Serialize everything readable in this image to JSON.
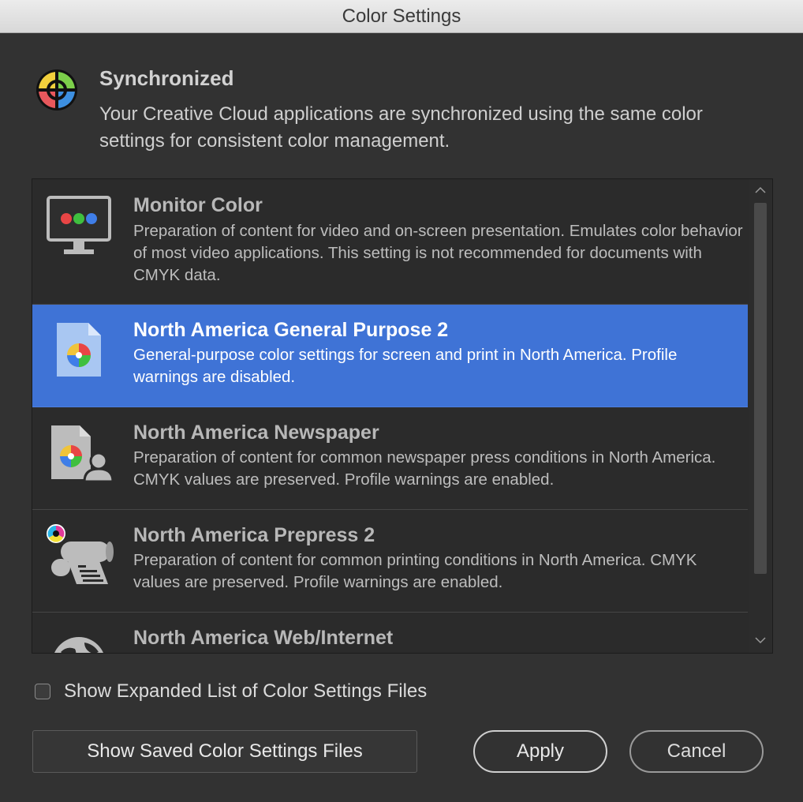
{
  "window": {
    "title": "Color Settings"
  },
  "sync": {
    "icon": "color-wheel-icon",
    "title": "Synchronized",
    "description": "Your Creative Cloud applications are synchronized using the same color settings for consistent color management."
  },
  "settings_list": {
    "items": [
      {
        "name": "Monitor Color",
        "description": "Preparation of content for video and on-screen presentation. Emulates color behavior of most video applications. This setting is not recommended for documents with CMYK data.",
        "icon": "monitor-icon",
        "selected": false
      },
      {
        "name": "North America General Purpose 2",
        "description": "General-purpose color settings for screen and print in North America. Profile warnings are disabled.",
        "icon": "document-color-icon",
        "selected": true
      },
      {
        "name": "North America Newspaper",
        "description": "Preparation of content for common newspaper press conditions in North America. CMYK values are preserved. Profile warnings are enabled.",
        "icon": "newspaper-icon",
        "selected": false
      },
      {
        "name": "North America Prepress 2",
        "description": "Preparation of content for common printing conditions in North America. CMYK values are preserved. Profile warnings are enabled.",
        "icon": "prepress-press-icon",
        "selected": false
      },
      {
        "name": "North America Web/Internet",
        "description": "",
        "icon": "globe-icon",
        "selected": false
      }
    ]
  },
  "expanded_list": {
    "label": "Show Expanded List of Color Settings Files",
    "checked": false
  },
  "buttons": {
    "saved_files": "Show Saved Color Settings Files",
    "apply": "Apply",
    "cancel": "Cancel"
  },
  "colors": {
    "selection": "#3f73d6",
    "background": "#323232",
    "list_background": "#2b2b2b"
  }
}
